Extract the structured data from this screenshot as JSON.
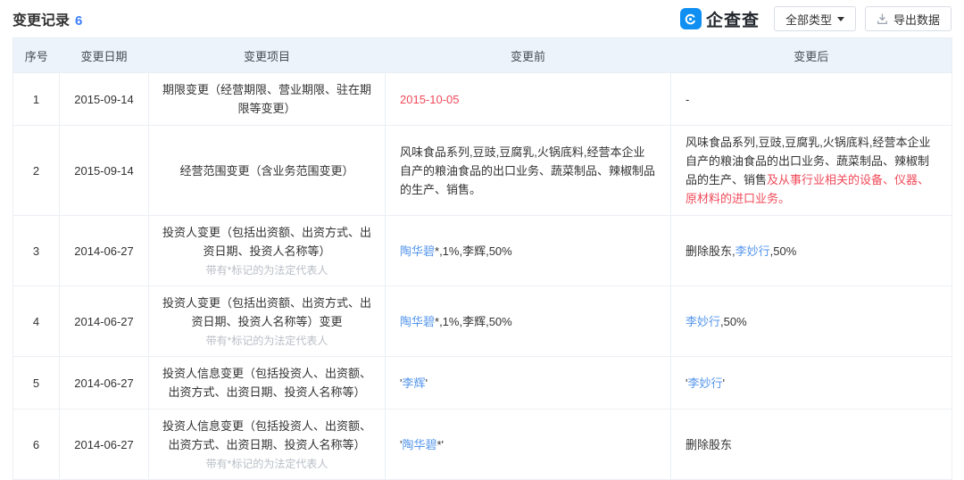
{
  "page": {
    "title": "变更记录",
    "count": "6"
  },
  "toolbar": {
    "brand": {
      "name": "企查查",
      "logo_color": "#0f8ff2"
    },
    "type_filter": {
      "label": "全部类型"
    },
    "export": {
      "label": "导出数据"
    }
  },
  "colors": {
    "accent_blue": "#3d7fff",
    "link_blue": "#5596ec",
    "alert_red": "#f04a5a",
    "header_bg": "#edf3fa",
    "border": "#ebeff4"
  },
  "table": {
    "columns": [
      "序号",
      "变更日期",
      "变更项目",
      "变更前",
      "变更后"
    ],
    "legal_rep_note": "带有*标记的为法定代表人",
    "rows": [
      {
        "no": "1",
        "date": "2015-09-14",
        "item": "期限变更（经营期限、营业期限、驻在期限等变更）",
        "note": false,
        "before": [
          {
            "t": "2015-10-05",
            "s": "red"
          }
        ],
        "after": [
          {
            "t": "-"
          }
        ]
      },
      {
        "no": "2",
        "date": "2015-09-14",
        "item": "经营范围变更（含业务范围变更）",
        "note": false,
        "before": [
          {
            "t": "风味食品系列,豆豉,豆腐乳,火锅底料,经营本企业自产的粮油食品的出口业务、蔬菜制品、辣椒制品的生产、销售。"
          }
        ],
        "after": [
          {
            "t": "风味食品系列,豆豉,豆腐乳,火锅底料,经营本企业自产的粮油食品的出口业务、蔬菜制品、辣椒制品的生产、销售"
          },
          {
            "t": "及从事行业相关的设备、仪器、原材料的进口业务。",
            "s": "red"
          }
        ]
      },
      {
        "no": "3",
        "date": "2014-06-27",
        "item": "投资人变更（包括出资额、出资方式、出资日期、投资人名称等）",
        "note": true,
        "before": [
          {
            "t": "陶华碧",
            "s": "link"
          },
          {
            "t": "*,1%,李辉,50%"
          }
        ],
        "after": [
          {
            "t": "删除股东,"
          },
          {
            "t": "李妙行",
            "s": "link"
          },
          {
            "t": ",50%"
          }
        ]
      },
      {
        "no": "4",
        "date": "2014-06-27",
        "item": "投资人变更（包括出资额、出资方式、出资日期、投资人名称等）变更",
        "note": true,
        "before": [
          {
            "t": "陶华碧",
            "s": "link"
          },
          {
            "t": "*,1%,李辉,50%"
          }
        ],
        "after": [
          {
            "t": "李妙行",
            "s": "link"
          },
          {
            "t": ",50%"
          }
        ]
      },
      {
        "no": "5",
        "date": "2014-06-27",
        "item": "投资人信息变更（包括投资人、出资额、出资方式、出资日期、投资人名称等）",
        "note": false,
        "before": [
          {
            "t": "'"
          },
          {
            "t": "李辉",
            "s": "link"
          },
          {
            "t": "'"
          }
        ],
        "after": [
          {
            "t": "'"
          },
          {
            "t": "李妙行",
            "s": "link"
          },
          {
            "t": "'"
          }
        ]
      },
      {
        "no": "6",
        "date": "2014-06-27",
        "item": "投资人信息变更（包括投资人、出资额、出资方式、出资日期、投资人名称等）",
        "note": true,
        "before": [
          {
            "t": "'"
          },
          {
            "t": "陶华碧",
            "s": "link"
          },
          {
            "t": "*'"
          }
        ],
        "after": [
          {
            "t": "删除股东"
          }
        ]
      }
    ]
  }
}
